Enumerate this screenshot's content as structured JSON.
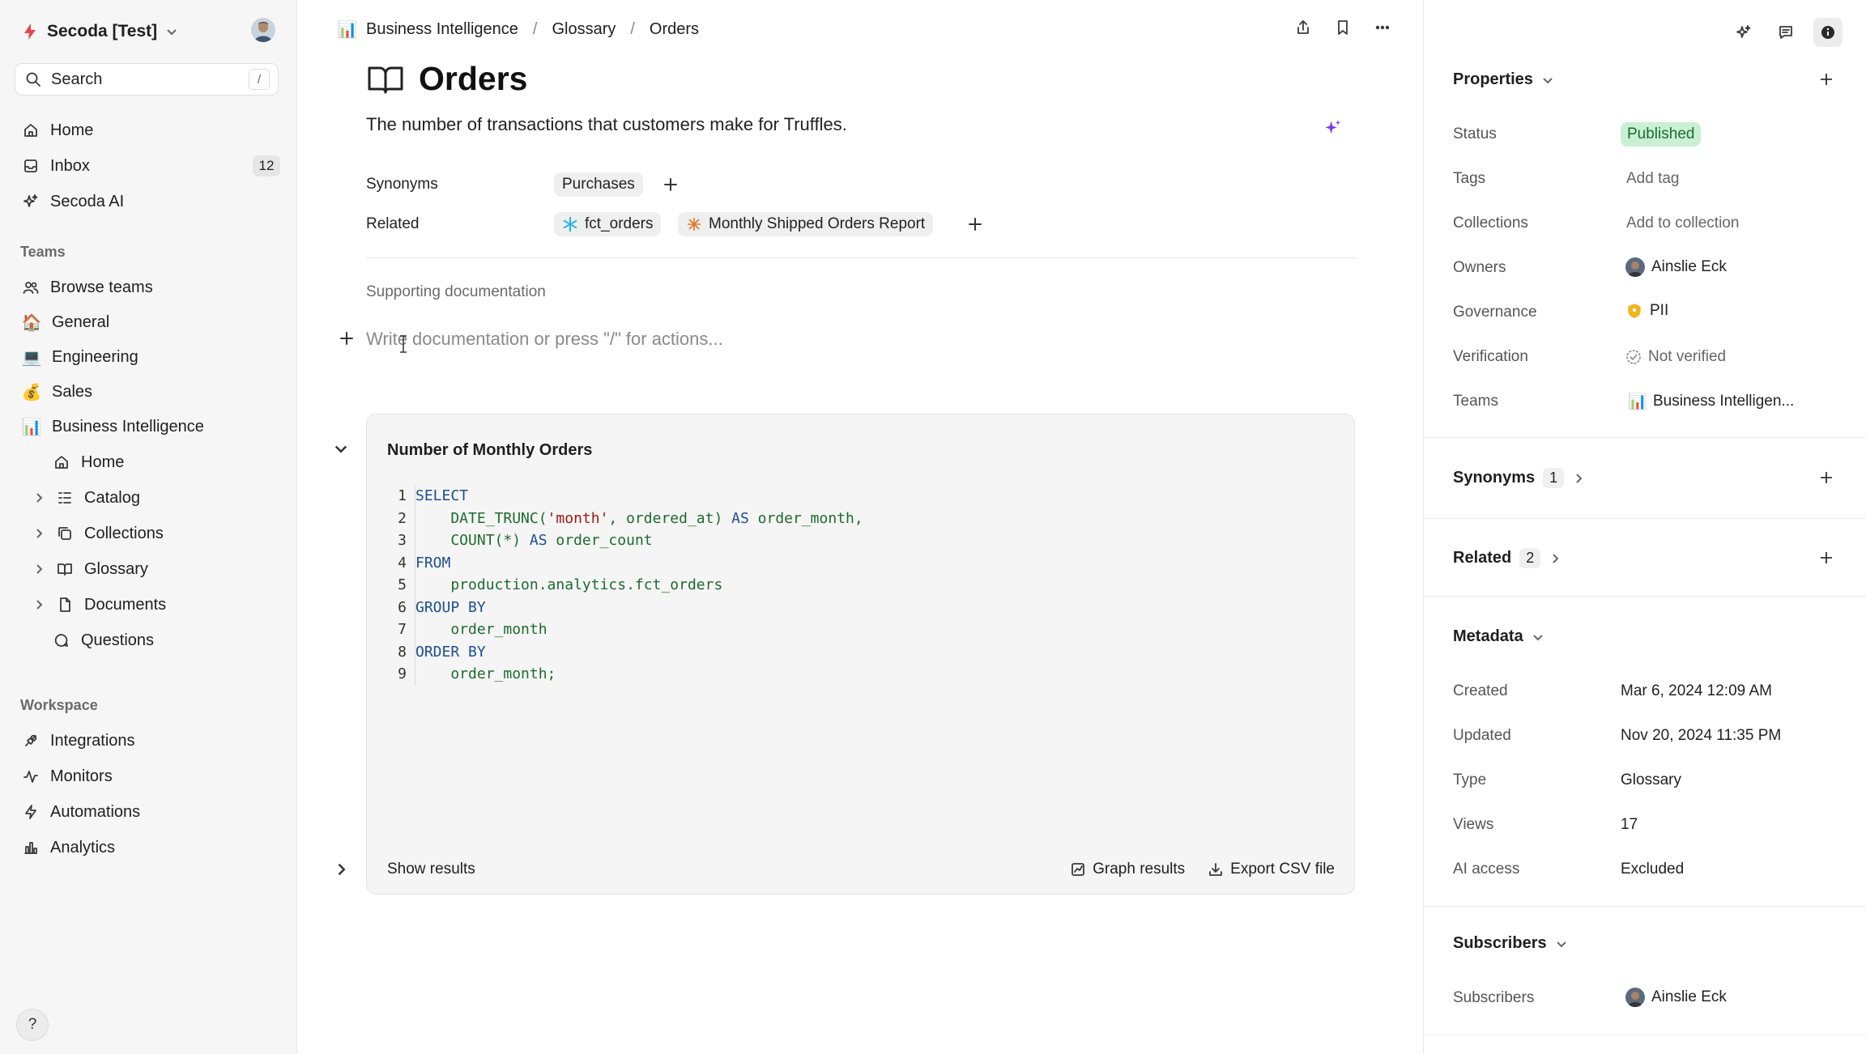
{
  "sidebar": {
    "workspace_name": "Secoda [Test]",
    "search": {
      "label": "Search",
      "shortcut": "/"
    },
    "nav": [
      {
        "label": "Home"
      },
      {
        "label": "Inbox",
        "badge": "12"
      },
      {
        "label": "Secoda AI"
      }
    ],
    "teams_label": "Teams",
    "teams": [
      {
        "label": "Browse teams"
      },
      {
        "label": "General",
        "emoji": "🏠"
      },
      {
        "label": "Engineering",
        "emoji": "💻"
      },
      {
        "label": "Sales",
        "emoji": "💰"
      },
      {
        "label": "Business Intelligence",
        "emoji": "📊"
      }
    ],
    "bi_children": [
      {
        "label": "Home"
      },
      {
        "label": "Catalog"
      },
      {
        "label": "Collections"
      },
      {
        "label": "Glossary"
      },
      {
        "label": "Documents"
      },
      {
        "label": "Questions"
      }
    ],
    "workspace_label": "Workspace",
    "workspace_items": [
      {
        "label": "Integrations"
      },
      {
        "label": "Monitors"
      },
      {
        "label": "Automations"
      },
      {
        "label": "Analytics"
      }
    ],
    "help": "?"
  },
  "breadcrumb": {
    "team_emoji": "📊",
    "items": [
      "Business Intelligence",
      "Glossary",
      "Orders"
    ],
    "separator": "/"
  },
  "page": {
    "title": "Orders",
    "description": "The number of transactions that customers make for Truffles.",
    "synonyms_label": "Synonyms",
    "synonyms": [
      "Purchases"
    ],
    "related_label": "Related",
    "related": [
      "fct_orders",
      "Monthly Shipped Orders Report"
    ],
    "supporting_label": "Supporting documentation",
    "editor_placeholder": "Write documentation or press \"/\" for actions..."
  },
  "query": {
    "title": "Number of Monthly Orders",
    "lines": [
      {
        "n": "1",
        "parts": [
          {
            "t": "SELECT",
            "c": "kw"
          }
        ]
      },
      {
        "n": "2",
        "parts": [
          {
            "t": "    DATE_TRUNC(",
            "c": "fn"
          },
          {
            "t": "'month'",
            "c": "str"
          },
          {
            "t": ", ordered_at) ",
            "c": "fn"
          },
          {
            "t": "AS",
            "c": "kw"
          },
          {
            "t": " order_month,",
            "c": "fn"
          }
        ]
      },
      {
        "n": "3",
        "parts": [
          {
            "t": "    COUNT(*) ",
            "c": "fn"
          },
          {
            "t": "AS",
            "c": "kw"
          },
          {
            "t": " order_count",
            "c": "fn"
          }
        ]
      },
      {
        "n": "4",
        "parts": [
          {
            "t": "FROM",
            "c": "kw"
          }
        ]
      },
      {
        "n": "5",
        "parts": [
          {
            "t": "    production.analytics.fct_orders",
            "c": "pl"
          }
        ]
      },
      {
        "n": "6",
        "parts": [
          {
            "t": "GROUP BY",
            "c": "kw"
          }
        ]
      },
      {
        "n": "7",
        "parts": [
          {
            "t": "    order_month",
            "c": "pl"
          }
        ]
      },
      {
        "n": "8",
        "parts": [
          {
            "t": "ORDER BY",
            "c": "kw"
          }
        ]
      },
      {
        "n": "9",
        "parts": [
          {
            "t": "    order_month;",
            "c": "pl"
          }
        ]
      }
    ],
    "show_results": "Show results",
    "graph_results": "Graph results",
    "export_csv": "Export CSV file"
  },
  "panel": {
    "properties_label": "Properties",
    "props": [
      {
        "label": "Status",
        "value": "Published"
      },
      {
        "label": "Tags",
        "value": "Add tag"
      },
      {
        "label": "Collections",
        "value": "Add to collection"
      },
      {
        "label": "Owners",
        "value": "Ainslie Eck"
      },
      {
        "label": "Governance",
        "value": "PII"
      },
      {
        "label": "Verification",
        "value": "Not verified"
      },
      {
        "label": "Teams",
        "value": "Business Intelligen...",
        "emoji": "📊"
      }
    ],
    "synonyms_label": "Synonyms",
    "synonyms_count": "1",
    "related_label": "Related",
    "related_count": "2",
    "metadata_label": "Metadata",
    "metadata": [
      {
        "label": "Created",
        "value": "Mar 6, 2024 12:09 AM"
      },
      {
        "label": "Updated",
        "value": "Nov 20, 2024 11:35 PM"
      },
      {
        "label": "Type",
        "value": "Glossary"
      },
      {
        "label": "Views",
        "value": "17"
      },
      {
        "label": "AI access",
        "value": "Excluded"
      }
    ],
    "subscribers_label": "Subscribers",
    "subscribers_row_label": "Subscribers",
    "subscriber": "Ainslie Eck"
  },
  "colors": {
    "brand": "#e8454b",
    "published_bg": "#c9f0d3",
    "ai_purple": "#7b3fe4"
  }
}
